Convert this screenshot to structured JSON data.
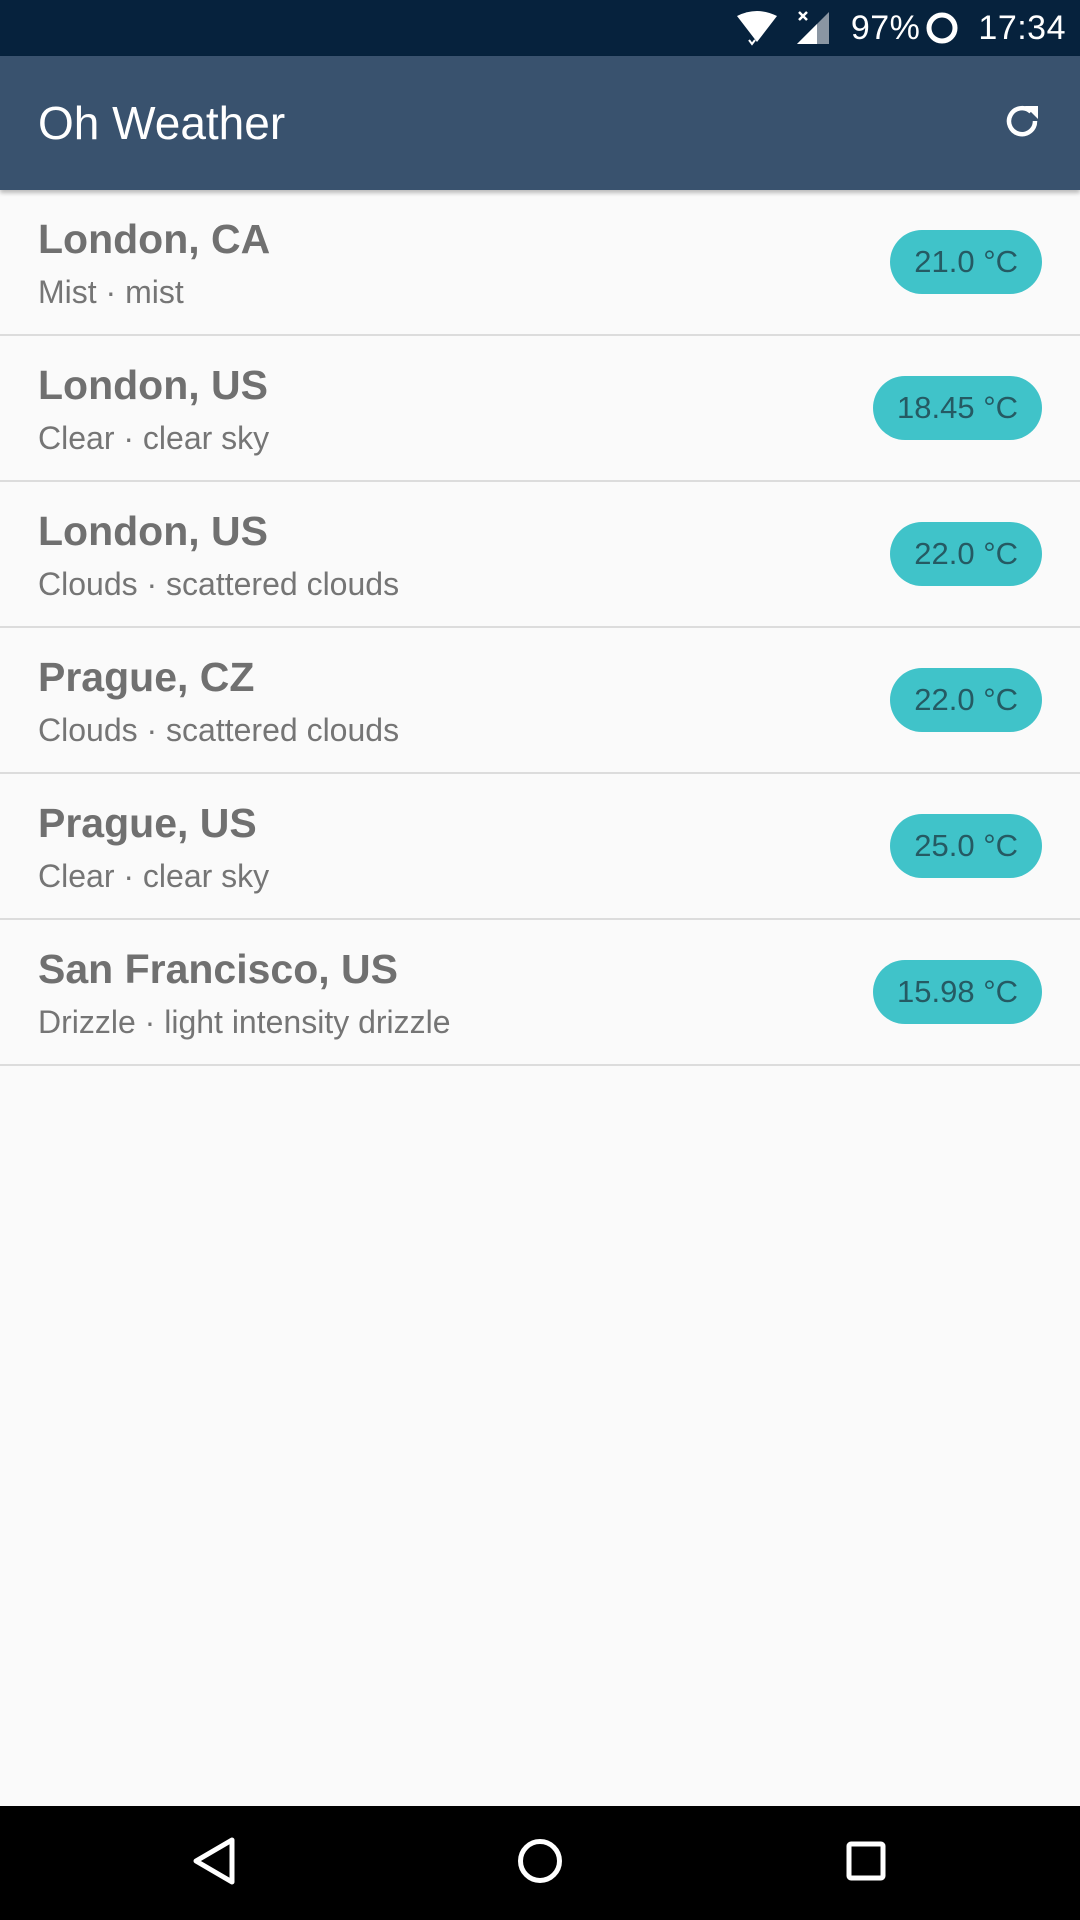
{
  "status_bar": {
    "battery": "97%",
    "time": "17:34",
    "icons": [
      "wifi-icon",
      "cell-signal-icon",
      "battery-icon"
    ]
  },
  "app_bar": {
    "title": "Oh Weather",
    "refresh_icon": "refresh-icon"
  },
  "cities": [
    {
      "name": "London, CA",
      "description": "Mist · mist",
      "temperature": "21.0 °C"
    },
    {
      "name": "London, US",
      "description": "Clear · clear sky",
      "temperature": "18.45 °C"
    },
    {
      "name": "London, US",
      "description": "Clouds · scattered clouds",
      "temperature": "22.0 °C"
    },
    {
      "name": "Prague, CZ",
      "description": "Clouds · scattered clouds",
      "temperature": "22.0 °C"
    },
    {
      "name": "Prague, US",
      "description": "Clear · clear sky",
      "temperature": "25.0 °C"
    },
    {
      "name": "San Francisco, US",
      "description": "Drizzle · light intensity drizzle",
      "temperature": "15.98 °C"
    }
  ],
  "nav_bar": {
    "icons": [
      "back-icon",
      "home-icon",
      "recents-icon"
    ]
  },
  "colors": {
    "status_bar": "#06223d",
    "app_bar": "#39526e",
    "badge": "#40c3c9",
    "badge_text": "#255a63",
    "background": "#fafafa"
  }
}
